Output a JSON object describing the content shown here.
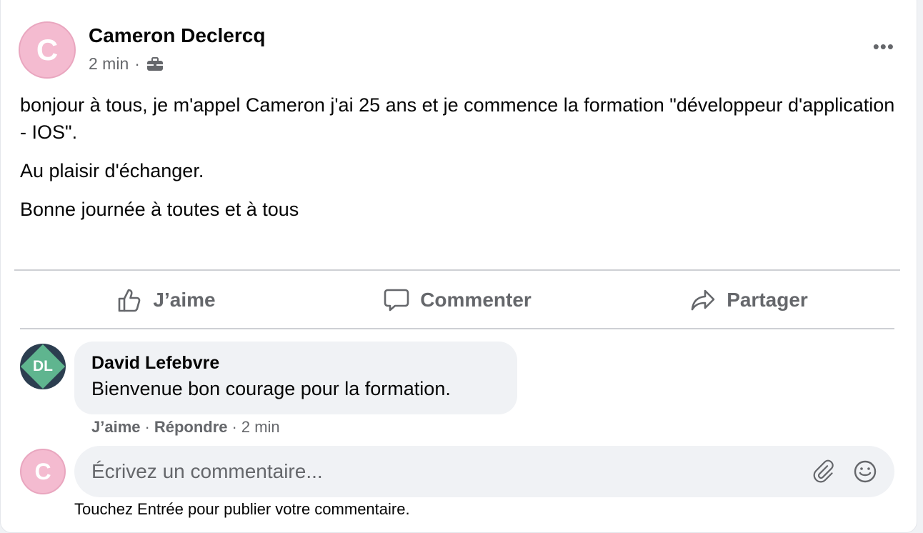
{
  "post": {
    "author": "Cameron Declercq",
    "avatar_letter": "C",
    "time": "2 min",
    "separator": "·",
    "more_label": "•••",
    "paragraphs": [
      "bonjour à tous, je m'appel Cameron j'ai 25 ans et je commence la formation \"développeur d'application - IOS\".",
      "Au plaisir d'échanger.",
      "Bonne journée à toutes et à tous"
    ]
  },
  "actions": {
    "like": "J’aime",
    "comment": "Commenter",
    "share": "Partager"
  },
  "comment": {
    "avatar_initials": "DL",
    "author": "David Lefebvre",
    "text": "Bienvenue bon courage pour la formation.",
    "like": "J’aime",
    "reply": "Répondre",
    "time": "2 min",
    "separator": "·"
  },
  "composer": {
    "avatar_letter": "C",
    "placeholder": "Écrivez un commentaire...",
    "hint": "Touchez Entrée pour publier votre commentaire."
  },
  "icons": {
    "audience": "briefcase-icon",
    "more": "more-options-icon",
    "like": "thumbs-up-icon",
    "comment": "comment-icon",
    "share": "share-icon",
    "attach": "paperclip-icon",
    "emoji": "smiley-icon"
  },
  "colors": {
    "avatar_pink": "#f4bbd0",
    "secondary_text": "#65676b",
    "bubble_bg": "#f0f2f5",
    "dl_avatar_bg": "#2c3e50",
    "dl_avatar_diamond": "#5fb58f"
  }
}
